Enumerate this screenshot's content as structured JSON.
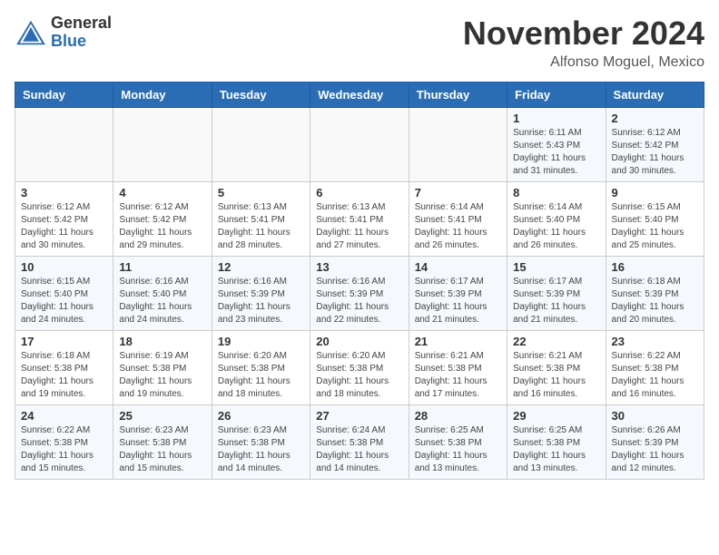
{
  "header": {
    "logo_line1": "General",
    "logo_line2": "Blue",
    "month": "November 2024",
    "location": "Alfonso Moguel, Mexico"
  },
  "weekdays": [
    "Sunday",
    "Monday",
    "Tuesday",
    "Wednesday",
    "Thursday",
    "Friday",
    "Saturday"
  ],
  "weeks": [
    [
      {
        "day": "",
        "info": ""
      },
      {
        "day": "",
        "info": ""
      },
      {
        "day": "",
        "info": ""
      },
      {
        "day": "",
        "info": ""
      },
      {
        "day": "",
        "info": ""
      },
      {
        "day": "1",
        "info": "Sunrise: 6:11 AM\nSunset: 5:43 PM\nDaylight: 11 hours and 31 minutes."
      },
      {
        "day": "2",
        "info": "Sunrise: 6:12 AM\nSunset: 5:42 PM\nDaylight: 11 hours and 30 minutes."
      }
    ],
    [
      {
        "day": "3",
        "info": "Sunrise: 6:12 AM\nSunset: 5:42 PM\nDaylight: 11 hours and 30 minutes."
      },
      {
        "day": "4",
        "info": "Sunrise: 6:12 AM\nSunset: 5:42 PM\nDaylight: 11 hours and 29 minutes."
      },
      {
        "day": "5",
        "info": "Sunrise: 6:13 AM\nSunset: 5:41 PM\nDaylight: 11 hours and 28 minutes."
      },
      {
        "day": "6",
        "info": "Sunrise: 6:13 AM\nSunset: 5:41 PM\nDaylight: 11 hours and 27 minutes."
      },
      {
        "day": "7",
        "info": "Sunrise: 6:14 AM\nSunset: 5:41 PM\nDaylight: 11 hours and 26 minutes."
      },
      {
        "day": "8",
        "info": "Sunrise: 6:14 AM\nSunset: 5:40 PM\nDaylight: 11 hours and 26 minutes."
      },
      {
        "day": "9",
        "info": "Sunrise: 6:15 AM\nSunset: 5:40 PM\nDaylight: 11 hours and 25 minutes."
      }
    ],
    [
      {
        "day": "10",
        "info": "Sunrise: 6:15 AM\nSunset: 5:40 PM\nDaylight: 11 hours and 24 minutes."
      },
      {
        "day": "11",
        "info": "Sunrise: 6:16 AM\nSunset: 5:40 PM\nDaylight: 11 hours and 24 minutes."
      },
      {
        "day": "12",
        "info": "Sunrise: 6:16 AM\nSunset: 5:39 PM\nDaylight: 11 hours and 23 minutes."
      },
      {
        "day": "13",
        "info": "Sunrise: 6:16 AM\nSunset: 5:39 PM\nDaylight: 11 hours and 22 minutes."
      },
      {
        "day": "14",
        "info": "Sunrise: 6:17 AM\nSunset: 5:39 PM\nDaylight: 11 hours and 21 minutes."
      },
      {
        "day": "15",
        "info": "Sunrise: 6:17 AM\nSunset: 5:39 PM\nDaylight: 11 hours and 21 minutes."
      },
      {
        "day": "16",
        "info": "Sunrise: 6:18 AM\nSunset: 5:39 PM\nDaylight: 11 hours and 20 minutes."
      }
    ],
    [
      {
        "day": "17",
        "info": "Sunrise: 6:18 AM\nSunset: 5:38 PM\nDaylight: 11 hours and 19 minutes."
      },
      {
        "day": "18",
        "info": "Sunrise: 6:19 AM\nSunset: 5:38 PM\nDaylight: 11 hours and 19 minutes."
      },
      {
        "day": "19",
        "info": "Sunrise: 6:20 AM\nSunset: 5:38 PM\nDaylight: 11 hours and 18 minutes."
      },
      {
        "day": "20",
        "info": "Sunrise: 6:20 AM\nSunset: 5:38 PM\nDaylight: 11 hours and 18 minutes."
      },
      {
        "day": "21",
        "info": "Sunrise: 6:21 AM\nSunset: 5:38 PM\nDaylight: 11 hours and 17 minutes."
      },
      {
        "day": "22",
        "info": "Sunrise: 6:21 AM\nSunset: 5:38 PM\nDaylight: 11 hours and 16 minutes."
      },
      {
        "day": "23",
        "info": "Sunrise: 6:22 AM\nSunset: 5:38 PM\nDaylight: 11 hours and 16 minutes."
      }
    ],
    [
      {
        "day": "24",
        "info": "Sunrise: 6:22 AM\nSunset: 5:38 PM\nDaylight: 11 hours and 15 minutes."
      },
      {
        "day": "25",
        "info": "Sunrise: 6:23 AM\nSunset: 5:38 PM\nDaylight: 11 hours and 15 minutes."
      },
      {
        "day": "26",
        "info": "Sunrise: 6:23 AM\nSunset: 5:38 PM\nDaylight: 11 hours and 14 minutes."
      },
      {
        "day": "27",
        "info": "Sunrise: 6:24 AM\nSunset: 5:38 PM\nDaylight: 11 hours and 14 minutes."
      },
      {
        "day": "28",
        "info": "Sunrise: 6:25 AM\nSunset: 5:38 PM\nDaylight: 11 hours and 13 minutes."
      },
      {
        "day": "29",
        "info": "Sunrise: 6:25 AM\nSunset: 5:38 PM\nDaylight: 11 hours and 13 minutes."
      },
      {
        "day": "30",
        "info": "Sunrise: 6:26 AM\nSunset: 5:39 PM\nDaylight: 11 hours and 12 minutes."
      }
    ]
  ]
}
